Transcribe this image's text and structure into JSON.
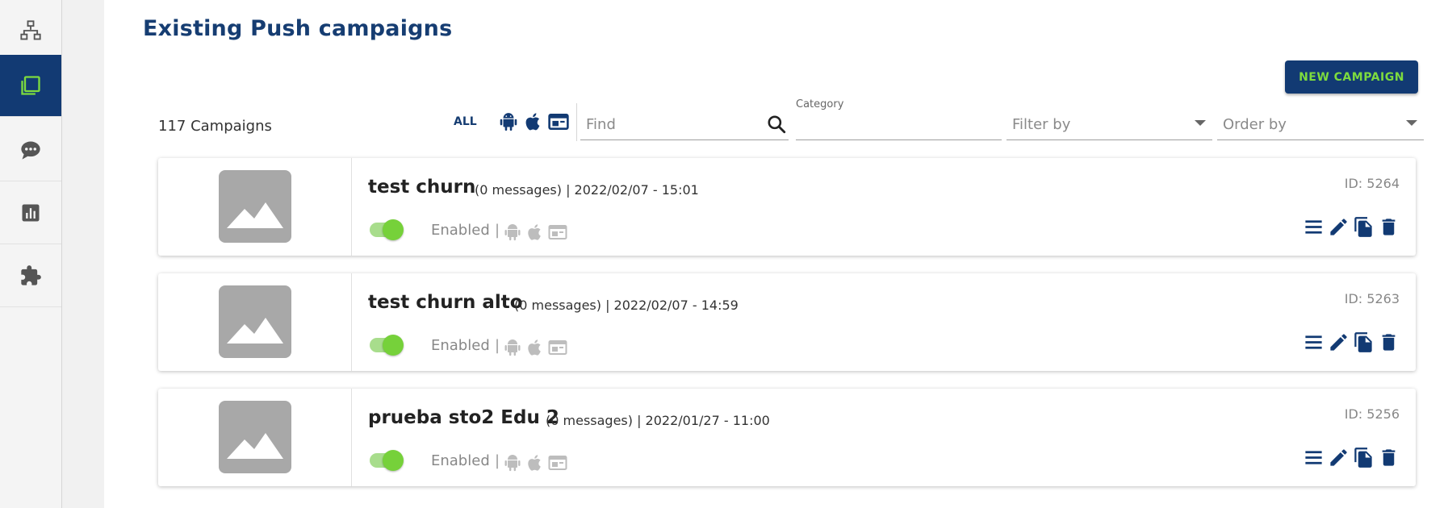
{
  "header": {
    "title": "Existing Push campaigns",
    "new_button": "NEW CAMPAIGN"
  },
  "sidebar": {
    "items": [
      {
        "icon": "sitemap-icon",
        "active": false
      },
      {
        "icon": "campaigns-icon",
        "active": true
      },
      {
        "icon": "chat-icon",
        "active": false
      },
      {
        "icon": "chart-icon",
        "active": false
      },
      {
        "icon": "puzzle-icon",
        "active": false
      }
    ]
  },
  "toolbar": {
    "count": "117 Campaigns",
    "all_label": "ALL",
    "platforms": [
      "android-icon",
      "apple-icon",
      "web-icon"
    ],
    "find_placeholder": "Find",
    "category_label": "Category",
    "category_value": "",
    "filter_placeholder": "Filter by",
    "order_placeholder": "Order by"
  },
  "campaigns": [
    {
      "name": "test churn",
      "meta": "(0 messages) | 2022/02/07 - 15:01",
      "status": "Enabled",
      "enabled": true,
      "id": "ID: 5264"
    },
    {
      "name": "test churn alto",
      "meta": "(0 messages) | 2022/02/07 - 14:59",
      "status": "Enabled",
      "enabled": true,
      "id": "ID: 5263"
    },
    {
      "name": "prueba sto2 Edu 2",
      "meta": "(0 messages) | 2022/01/27 - 11:00",
      "status": "Enabled",
      "enabled": true,
      "id": "ID: 5256"
    }
  ],
  "colors": {
    "primary": "#123a73",
    "accent": "#76d13a",
    "title": "#163d72"
  }
}
